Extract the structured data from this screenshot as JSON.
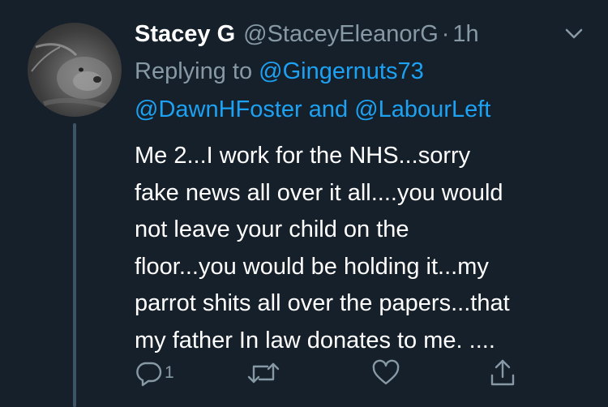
{
  "tweet": {
    "display_name": "Stacey G",
    "handle": "@StaceyEleanorG",
    "separator": "·",
    "time": "1h",
    "replying_prefix": "Replying to",
    "reply_to_1": "@Gingernuts73",
    "reply_to_2": "@DawnHFoster",
    "reply_joiner": "and",
    "reply_to_3": "@LabourLeft",
    "body_lines": [
      "Me 2...I work for the NHS...sorry",
      "fake news all over it all....you would",
      "not leave your child on the",
      "floor...you would be holding it...my",
      "parrot shits all over the papers...that",
      "my father In law donates to me. ...."
    ]
  },
  "actions": {
    "reply_count": "1",
    "icons": [
      "reply-icon",
      "retweet-icon",
      "like-icon",
      "share-icon",
      "chevron-down-icon"
    ]
  },
  "colors": {
    "background": "#15202b",
    "text": "#ffffff",
    "muted": "#8899a6",
    "link": "#1da1f2",
    "thread_line": "#3d5466"
  }
}
